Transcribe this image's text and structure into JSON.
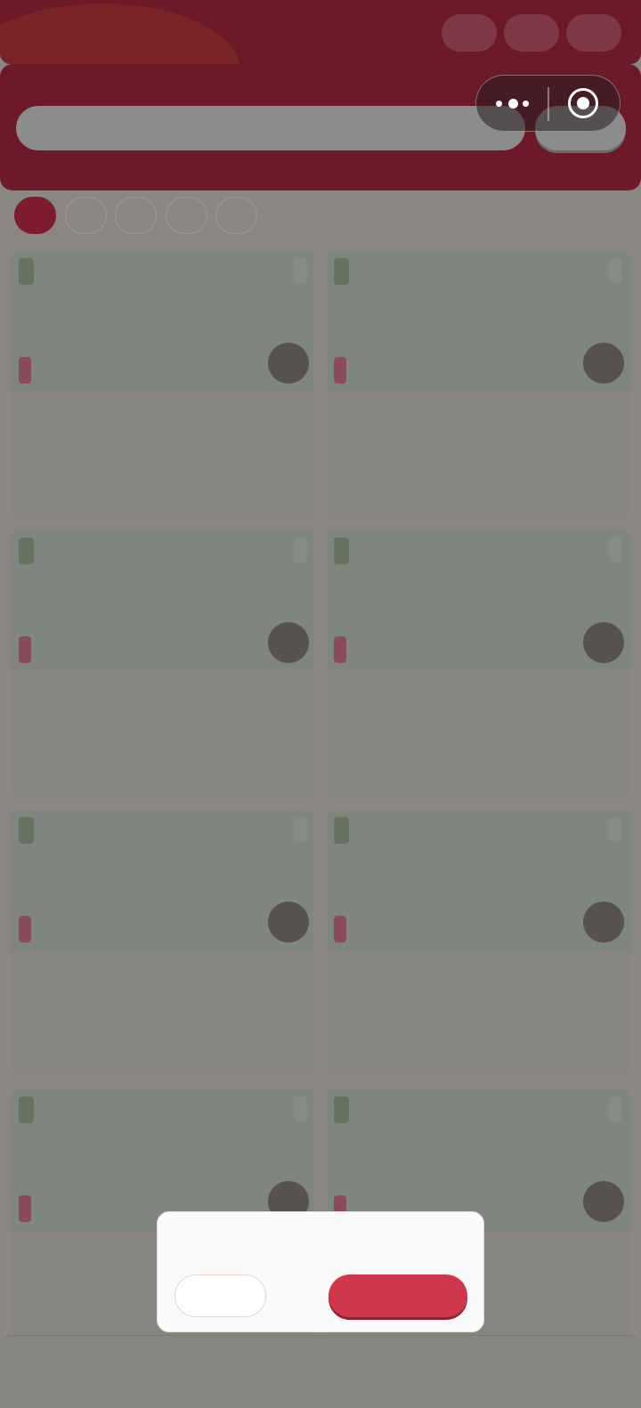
{
  "header": {
    "pills": [
      "",
      "",
      ""
    ]
  },
  "search": {
    "placeholder": "",
    "button_label": ""
  },
  "capsule": {
    "more_icon": "more-dots-icon",
    "close_icon": "target-close-icon"
  },
  "filter_tabs": [
    {
      "label": "",
      "active": true
    },
    {
      "label": "",
      "active": false
    },
    {
      "label": "",
      "active": false
    },
    {
      "label": "",
      "active": false
    },
    {
      "label": "",
      "active": false
    }
  ],
  "products": [
    {
      "title": "",
      "price": ""
    },
    {
      "title": "",
      "price": ""
    },
    {
      "title": "",
      "price": ""
    },
    {
      "title": "",
      "price": ""
    },
    {
      "title": "",
      "price": ""
    },
    {
      "title": "",
      "price": ""
    },
    {
      "title": "",
      "price": ""
    },
    {
      "title": "",
      "price": ""
    }
  ],
  "dialog": {
    "message": "",
    "cancel_label": "",
    "confirm_label": ""
  },
  "colors": {
    "brand": "#6d1a28",
    "accent": "#d0374c",
    "active_tab": "#7d1c2c"
  }
}
